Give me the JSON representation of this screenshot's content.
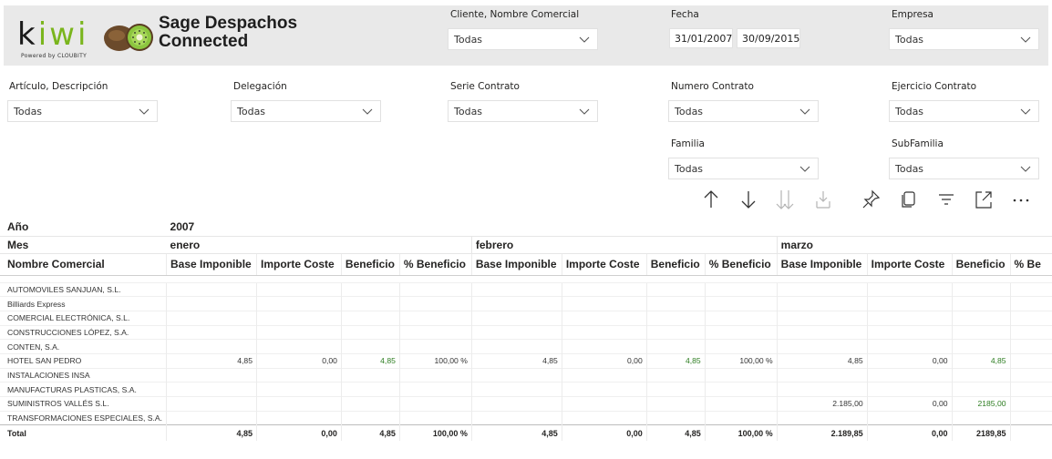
{
  "brand": {
    "logo_word_k": "k",
    "logo_word_i1": "i",
    "logo_word_w": "w",
    "logo_word_i2": "i",
    "powered_by": "Powered   by   CLOUBITY",
    "title_line1": "Sage Despachos",
    "title_line2": "Connected",
    "accent_green": "#7ab51d"
  },
  "filters": {
    "cliente": {
      "label": "Cliente, Nombre Comercial",
      "value": "Todas"
    },
    "fecha": {
      "label": "Fecha",
      "start": "31/01/2007",
      "end": "30/09/2015"
    },
    "empresa": {
      "label": "Empresa",
      "value": "Todas"
    },
    "articulo": {
      "label": "Artículo, Descripción",
      "value": "Todas"
    },
    "delegacion": {
      "label": "Delegación",
      "value": "Todas"
    },
    "serie": {
      "label": "Serie Contrato",
      "value": "Todas"
    },
    "numero": {
      "label": "Numero Contrato",
      "value": "Todas"
    },
    "ejercicio": {
      "label": "Ejercicio Contrato",
      "value": "Todas"
    },
    "familia": {
      "label": "Familia",
      "value": "Todas"
    },
    "subfamilia": {
      "label": "SubFamilia",
      "value": "Todas"
    }
  },
  "toolbar": {
    "icons": [
      "arrow-up-icon",
      "arrow-down-icon",
      "double-arrow-down-icon",
      "expand-hierarchy-icon",
      "pin-icon",
      "copy-icon",
      "filter-icon",
      "focus-mode-icon",
      "more-options-icon"
    ]
  },
  "matrix": {
    "row_year_label": "Año",
    "year": "2007",
    "row_month_label": "Mes",
    "months": [
      "enero",
      "febrero",
      "marzo"
    ],
    "name_header": "Nombre Comercial",
    "columns": [
      "Base Imponible",
      "Importe Coste",
      "Beneficio",
      "% Beneficio"
    ],
    "last_col_partial": "% Be",
    "rows": [
      {
        "name": "AUTOMOVILES SANJUAN, S.L.",
        "cells": [
          "",
          "",
          "",
          "",
          "",
          "",
          "",
          "",
          "",
          "",
          "",
          ""
        ]
      },
      {
        "name": "Billiards Express",
        "cells": [
          "",
          "",
          "",
          "",
          "",
          "",
          "",
          "",
          "",
          "",
          "",
          ""
        ]
      },
      {
        "name": "COMERCIAL ELECTRÓNICA, S.L.",
        "cells": [
          "",
          "",
          "",
          "",
          "",
          "",
          "",
          "",
          "",
          "",
          "",
          ""
        ]
      },
      {
        "name": "CONSTRUCCIONES LÓPEZ, S.A.",
        "cells": [
          "",
          "",
          "",
          "",
          "",
          "",
          "",
          "",
          "",
          "",
          "",
          ""
        ]
      },
      {
        "name": "CONTEN, S.A.",
        "cells": [
          "",
          "",
          "",
          "",
          "",
          "",
          "",
          "",
          "",
          "",
          "",
          ""
        ]
      },
      {
        "name": "HOTEL SAN PEDRO",
        "cells": [
          "4,85",
          "0,00",
          "4,85",
          "100,00 %",
          "4,85",
          "0,00",
          "4,85",
          "100,00 %",
          "4,85",
          "0,00",
          "4,85",
          ""
        ]
      },
      {
        "name": "INSTALACIONES INSA",
        "cells": [
          "",
          "",
          "",
          "",
          "",
          "",
          "",
          "",
          "",
          "",
          "",
          ""
        ]
      },
      {
        "name": "MANUFACTURAS PLASTICAS, S.A.",
        "cells": [
          "",
          "",
          "",
          "",
          "",
          "",
          "",
          "",
          "",
          "",
          "",
          ""
        ]
      },
      {
        "name": "SUMINISTROS VALLÉS S.L.",
        "cells": [
          "",
          "",
          "",
          "",
          "",
          "",
          "",
          "",
          "2.185,00",
          "0,00",
          "2185,00",
          ""
        ]
      },
      {
        "name": "TRANSFORMACIONES ESPECIALES, S.A.",
        "cells": [
          "",
          "",
          "",
          "",
          "",
          "",
          "",
          "",
          "",
          "",
          "",
          ""
        ]
      }
    ],
    "total": {
      "name": "Total",
      "cells": [
        "4,85",
        "0,00",
        "4,85",
        "100,00 %",
        "4,85",
        "0,00",
        "4,85",
        "100,00 %",
        "2.189,85",
        "0,00",
        "2189,85",
        ""
      ]
    },
    "positive_color": "#2d7d21"
  }
}
